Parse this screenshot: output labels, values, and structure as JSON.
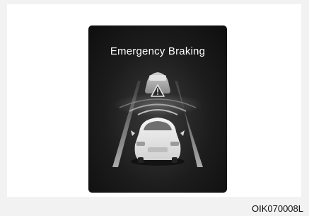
{
  "panel": {
    "title": "Emergency Braking",
    "warning_icon": "warning-triangle-icon",
    "lead_vehicle_icon": "lead-vehicle-icon",
    "own_vehicle_icon": "own-vehicle-icon"
  },
  "caption": "OIK070008L"
}
